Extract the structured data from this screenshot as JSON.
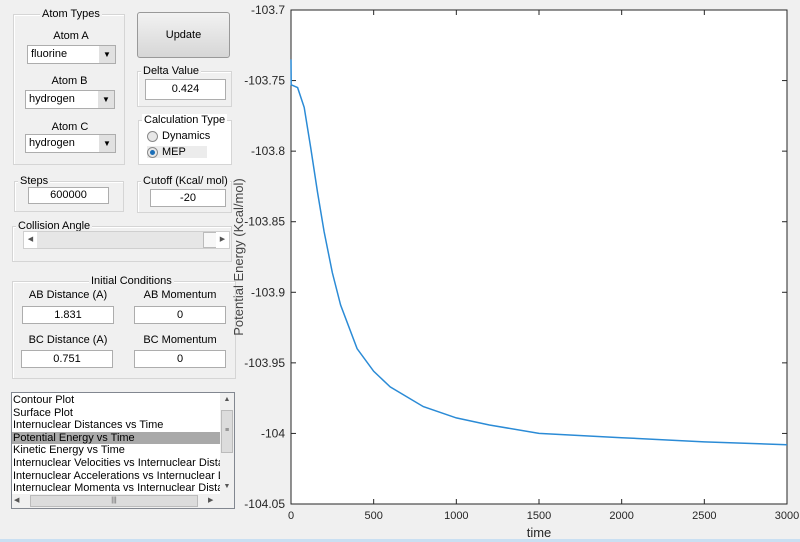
{
  "atom_types": {
    "title": "Atom Types",
    "atom_a": {
      "label": "Atom A",
      "value": "fluorine"
    },
    "atom_b": {
      "label": "Atom B",
      "value": "hydrogen"
    },
    "atom_c": {
      "label": "Atom C",
      "value": "hydrogen"
    }
  },
  "update_label": "Update",
  "delta": {
    "title": "Delta Value",
    "value": "0.424"
  },
  "calc_type": {
    "title": "Calculation Type",
    "options": [
      "Dynamics",
      "MEP"
    ],
    "selected": "MEP"
  },
  "steps": {
    "title": "Steps",
    "value": "600000"
  },
  "cutoff": {
    "title": "Cutoff (Kcal/ mol)",
    "value": "-20"
  },
  "collision": {
    "title": "Collision Angle",
    "slider_fraction": 1.0
  },
  "initial": {
    "title": "Initial Conditions",
    "ab_dist_label": "AB Distance (A)",
    "ab_dist": "1.831",
    "ab_mom_label": "AB Momentum",
    "ab_mom": "0",
    "bc_dist_label": "BC Distance (A)",
    "bc_dist": "0.751",
    "bc_mom_label": "BC Momentum",
    "bc_mom": "0"
  },
  "plot_list": {
    "items": [
      "Contour Plot",
      "Surface Plot",
      "Internuclear Distances vs Time",
      "Potential Energy vs Time",
      "Kinetic Energy vs Time",
      "Internuclear Velocities vs Internuclear Distance",
      "Internuclear Accelerations vs Internuclear Distance",
      "Internuclear Momenta vs Internuclear Distance"
    ],
    "selected": "Potential Energy vs Time"
  },
  "chart_data": {
    "type": "line",
    "xlabel": "time",
    "ylabel": "Potential Energy (Kcal/mol)",
    "xlim": [
      0,
      3000
    ],
    "ylim": [
      -104.05,
      -103.7
    ],
    "xticks": [
      "0",
      "500",
      "1000",
      "1500",
      "2000",
      "2500",
      "3000"
    ],
    "yticks": [
      "-103.7",
      "-103.75",
      "-103.8",
      "-103.85",
      "-103.9",
      "-103.95",
      "-104",
      "-104.05"
    ],
    "grid": false,
    "color": "#2b8bd6",
    "x": [
      0,
      1,
      40,
      80,
      120,
      160,
      200,
      250,
      300,
      400,
      500,
      600,
      800,
      1000,
      1200,
      1500,
      2000,
      2500,
      3000
    ],
    "y": [
      -103.735,
      -103.753,
      -103.755,
      -103.769,
      -103.798,
      -103.829,
      -103.857,
      -103.886,
      -103.909,
      -103.94,
      -103.956,
      -103.967,
      -103.981,
      -103.989,
      -103.994,
      -104.0,
      -104.003,
      -104.006,
      -104.008
    ]
  }
}
